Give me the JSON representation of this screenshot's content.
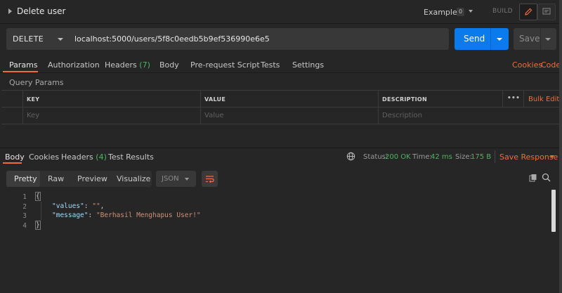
{
  "request": {
    "title": "Delete user",
    "examples_label": "Examples",
    "examples_count": "0",
    "build_label": "BUILD",
    "method": "DELETE",
    "url": "localhost:5000/users/5f8c0eedb5b9ef536990e6e5",
    "send_label": "Send",
    "save_label": "Save"
  },
  "request_tabs": {
    "params": "Params",
    "authorization": "Authorization",
    "headers": "Headers",
    "headers_count": "(7)",
    "body": "Body",
    "prerequest": "Pre-request Script",
    "tests": "Tests",
    "settings": "Settings",
    "cookies": "Cookies",
    "code": "Code"
  },
  "params": {
    "section_label": "Query Params",
    "columns": [
      "KEY",
      "VALUE",
      "DESCRIPTION"
    ],
    "bulk_edit": "Bulk Edit",
    "more": "•••",
    "placeholders": {
      "key": "Key",
      "value": "Value",
      "description": "Description"
    }
  },
  "response_tabs": {
    "body": "Body",
    "cookies": "Cookies",
    "headers": "Headers",
    "headers_count": "(4)",
    "test_results": "Test Results"
  },
  "status": {
    "status_label": "Status:",
    "status_value": "200 OK",
    "time_label": "Time:",
    "time_value": "42 ms",
    "size_label": "Size:",
    "size_value": "175 B",
    "save_response": "Save Response"
  },
  "view": {
    "pretty": "Pretty",
    "raw": "Raw",
    "preview": "Preview",
    "visualize": "Visualize",
    "format": "JSON"
  },
  "code": {
    "line_numbers": [
      "1",
      "2",
      "3",
      "4"
    ],
    "open_brace": "{",
    "close_brace": "}",
    "values_key": "\"values\"",
    "values_val": "\"\"",
    "message_key": "\"message\"",
    "message_val": "\"Berhasil Menghapus User!\""
  },
  "colors": {
    "accent": "#f26b3a",
    "send": "#097bed",
    "success": "#4fb462"
  }
}
